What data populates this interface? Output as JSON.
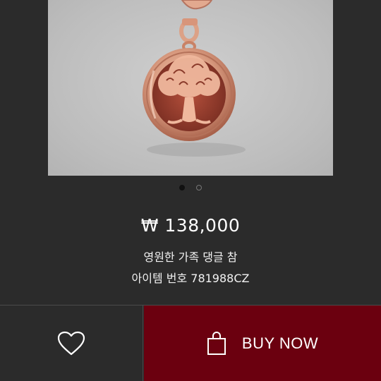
{
  "product": {
    "price": "₩ 138,000",
    "name": "영원한 가족 댕글 참",
    "item_number": "아이템 번호 781988CZ"
  },
  "gallery": {
    "image_count": 2,
    "active_index": 0
  },
  "actions": {
    "wishlist_icon": "heart-icon",
    "buy_icon": "shopping-bag-icon",
    "buy_label": "BUY NOW"
  },
  "colors": {
    "background": "#2b2b2b",
    "buy_button": "#6b000f",
    "image_bg": "#c4c4c4"
  }
}
